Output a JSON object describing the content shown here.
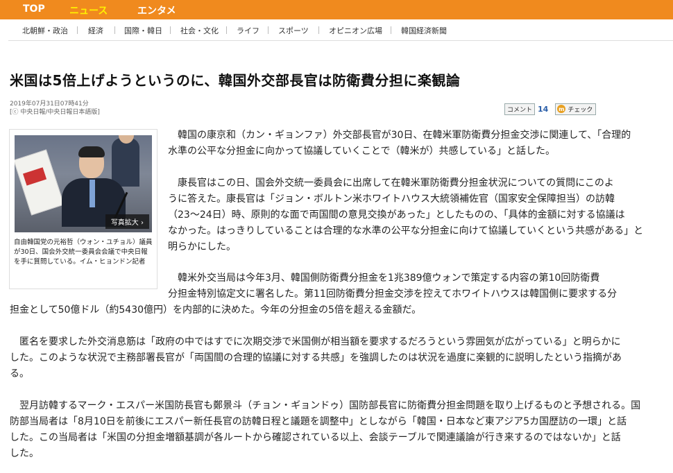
{
  "topnav": {
    "items": [
      "TOP",
      "ニュース",
      "エンタメ"
    ]
  },
  "subnav": {
    "items": [
      "北朝鮮・政治",
      "経済",
      "国際・韓日",
      "社会・文化",
      "ライフ",
      "スポーツ",
      "オピニオン広場",
      "韓国経済新聞"
    ]
  },
  "article": {
    "title": "米国は5倍上げようというのに、韓国外交部長官は防衛費分担に楽観論",
    "date": "2019年07月31日07時41分",
    "source": "[ⓒ 中央日報/中央日報日本語版]",
    "comment_label": "コメント",
    "comment_count": "14",
    "check_icon": "m",
    "check_label": "チェック",
    "photo": {
      "enlarge_label": "写真拡大 ›",
      "caption": "自由韓国党の元裕哲（ウォン・ユチョル）議員が30日、国会外交統一委員会会議で中央日報を手に質問している。イム・ヒョンドン記者"
    },
    "paragraphs": [
      [
        "韓国の康京和（カン・ギョンファ）外交部長官が30日、在韓米軍防衛費分担金交渉に関連して、「合理的",
        "水準の公平な分担金に向かって協議していくことで（韓米が）共感している」と話した。"
      ],
      [
        "康長官はこの日、国会外交統一委員会に出席して在韓米軍防衛費分担金状況についての質問にこのよ",
        "うに答えた。康長官は「ジョン・ボルトン米ホワイトハウス大統領補佐官（国家安全保障担当）の訪韓",
        "（23～24日）時、原則的な面で両国間の意見交換があった」としたものの、「具体的金額に対する協議は",
        "なかった。はっきりしていることは合理的な水準の公平な分担金に向けて協議していくという共感がある」と",
        "明らかにした。"
      ],
      [
        "韓米外交当局は今年3月、韓国側防衛費分担金を1兆389億ウォンで策定する内容の第10回防衛費",
        "分担金特別協定文に署名した。第11回防衛費分担金交渉を控えてホワイトハウスは韓国側に要求する分",
        "担金として50億ドル（約5430億円）を内部的に決めた。今年の分担金の5倍を超える金額だ。"
      ],
      [
        "匿名を要求した外交消息筋は「政府の中ではすでに次期交渉で米国側が相当額を要求するだろうという雰囲気が広がっている」と明らかに",
        "した。このような状況で主務部署長官が「両国間の合理的協議に対する共感」を強調したのは状況を過度に楽観的に説明したという指摘があ",
        "る。"
      ],
      [
        "翌月訪韓するマーク・エスパー米国防長官も鄭景斗（チョン・ギョンドゥ）国防部長官に防衛費分担金問題を取り上げるものと予想される。国",
        "防部当局者は「8月10日を前後にエスパー新任長官の訪韓日程と議題を調整中」としながら「韓国・日本など東アジア5カ国歴訪の一環」と話",
        "した。この当局者は「米国の分担金増額基調が各ルートから確認されている以上、会談テーブルで関連議論が行き来するのではないか」と話",
        "した。"
      ]
    ]
  }
}
